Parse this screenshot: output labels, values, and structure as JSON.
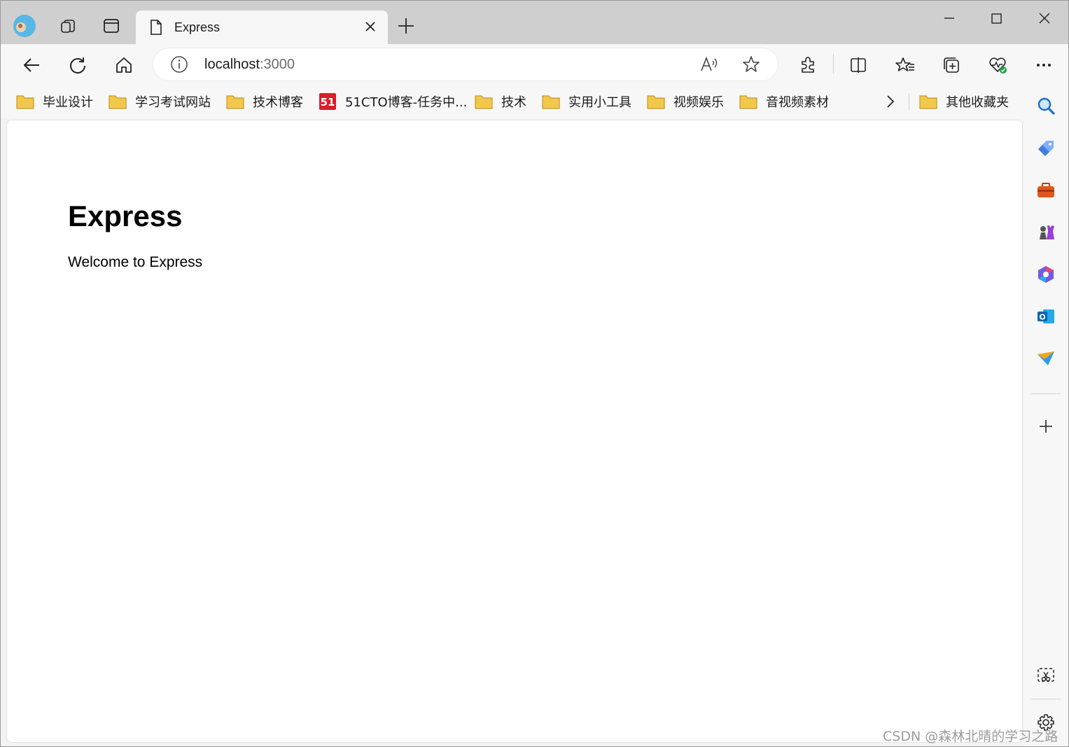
{
  "browser": {
    "tab": {
      "title": "Express"
    },
    "address": {
      "host": "localhost",
      "port": ":3000"
    }
  },
  "bookmarks": [
    {
      "label": "毕业设计",
      "icon": "folder-icon"
    },
    {
      "label": "学习考试网站",
      "icon": "folder-icon"
    },
    {
      "label": "技术博客",
      "icon": "folder-icon"
    },
    {
      "label": "51CTO博客-任务中...",
      "icon": "51cto-icon"
    },
    {
      "label": "技术",
      "icon": "folder-icon"
    },
    {
      "label": "实用小工具",
      "icon": "folder-icon"
    },
    {
      "label": "视频娱乐",
      "icon": "folder-icon"
    },
    {
      "label": "音视频素材",
      "icon": "folder-icon"
    }
  ],
  "other_bookmarks": {
    "label": "其他收藏夹"
  },
  "page": {
    "heading": "Express",
    "text": "Welcome to Express"
  },
  "watermark": "CSDN @森林北晴的学习之路",
  "colors": {
    "folder": "#f2c84b",
    "accent": "#0078d4",
    "cto_red": "#d71e2a"
  }
}
